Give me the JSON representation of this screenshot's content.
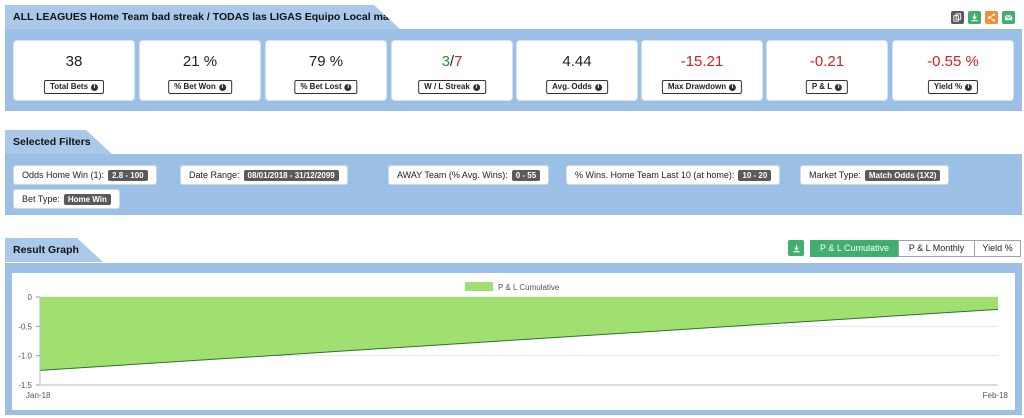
{
  "header": {
    "title": "ALL LEAGUES Home Team bad streak / TODAS las LIGAS Equipo Local mala racha"
  },
  "top_buttons": [
    {
      "name": "copy-icon",
      "color": "#5b5b5b"
    },
    {
      "name": "download-icon",
      "color": "#3fae6f"
    },
    {
      "name": "share-icon",
      "color": "#f0913a"
    },
    {
      "name": "email-icon",
      "color": "#3fae6f"
    }
  ],
  "stats": [
    {
      "value": "38",
      "label": "Total Bets"
    },
    {
      "value": "21 %",
      "label": "% Bet Won"
    },
    {
      "value": "79 %",
      "label": "% Bet Lost"
    },
    {
      "value_won": "3",
      "value_sep": "/",
      "value_lost": "7",
      "label": "W / L Streak"
    },
    {
      "value": "4.44",
      "label": "Avg. Odds"
    },
    {
      "value": "-15.21",
      "label": "Max Drawdown"
    },
    {
      "value": "-0.21",
      "label": "P & L"
    },
    {
      "value": "-0.55 %",
      "label": "Yield %"
    }
  ],
  "filters_section": {
    "title": "Selected Filters",
    "items": [
      {
        "label": "Odds Home Win (1):",
        "value": "2.8 - 100"
      },
      {
        "label": "Date Range:",
        "value": "08/01/2018 - 31/12/2099"
      },
      {
        "label": "AWAY Team (% Avg. Wins):",
        "value": "0 - 55"
      },
      {
        "label": "% Wins. Home Team Last 10 (at home):",
        "value": "10 - 20"
      },
      {
        "label": "Market Type:",
        "value": "Match Odds (1X2)"
      },
      {
        "label": "Bet Type:",
        "value": "Home Win"
      }
    ]
  },
  "graph_section": {
    "title": "Result Graph",
    "tabs": [
      {
        "label": "P & L Cumulative",
        "active": true
      },
      {
        "label": "P & L Monthly",
        "active": false
      },
      {
        "label": "Yield %",
        "active": false
      }
    ]
  },
  "colors": {
    "band": "#9cbfe5",
    "accent_green": "#3fae6f",
    "area_fill": "#9fe070",
    "area_line": "#2f6f2f",
    "negative": "#d0202a"
  },
  "chart_data": {
    "type": "area",
    "legend": "P & L Cumulative",
    "legend_position": "top-center",
    "x": [
      "Jan-18",
      "Feb-18"
    ],
    "series": [
      {
        "name": "P & L Cumulative",
        "values": [
          -1.25,
          -0.21
        ]
      }
    ],
    "yticks": [
      "0",
      "-0.5",
      "-1.0",
      "-1.5"
    ],
    "ylim": [
      -1.5,
      0
    ],
    "grid": true
  }
}
